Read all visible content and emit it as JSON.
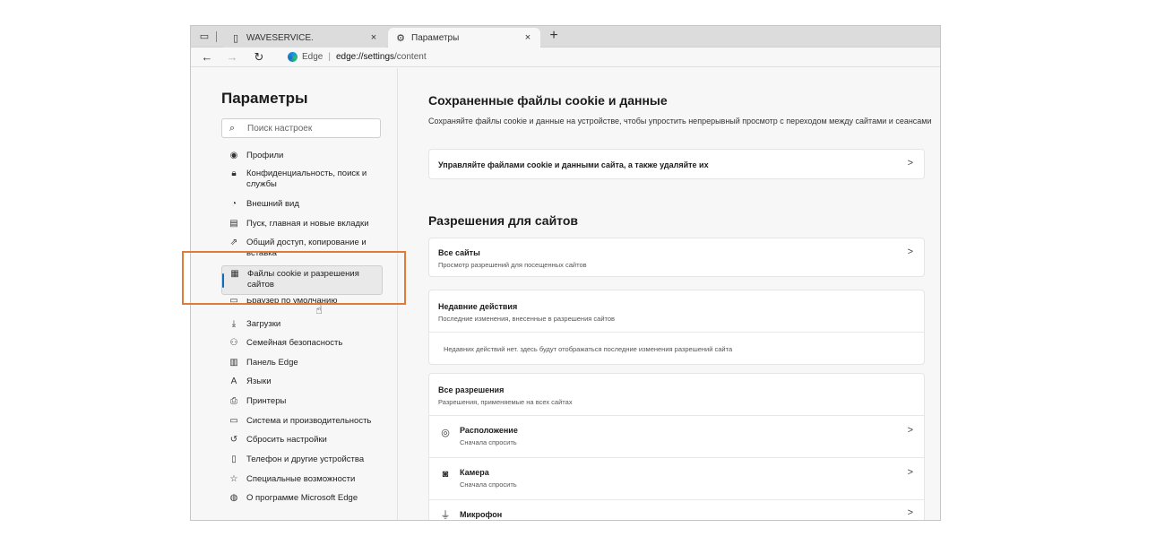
{
  "browser": {
    "tabs": [
      {
        "label": "WAVESERVICE.",
        "icon": "page-icon",
        "close": "×"
      },
      {
        "label": "Параметры",
        "icon": "gear-icon",
        "close": "×"
      }
    ],
    "new_tab": "+",
    "address": {
      "site_label": "Edge",
      "url_host": "edge://settings",
      "url_path": "/content"
    }
  },
  "sidebar": {
    "title": "Параметры",
    "search_placeholder": "Поиск настроек",
    "items": [
      {
        "label": "Профили",
        "icon": "profile-icon"
      },
      {
        "label": "Конфиденциальность, поиск и службы",
        "icon": "lock-icon"
      },
      {
        "label": "Внешний вид",
        "icon": "appearance-icon"
      },
      {
        "label": "Пуск, главная и новые вкладки",
        "icon": "start-icon"
      },
      {
        "label": "Общий доступ, копирование и вставка",
        "icon": "share-icon"
      },
      {
        "label": "Файлы cookie и разрешения сайтов",
        "icon": "cookie-icon",
        "selected": true
      },
      {
        "label": "Браузер по умолчанию",
        "icon": "browser-icon"
      },
      {
        "label": "Загрузки",
        "icon": "download-icon"
      },
      {
        "label": "Семейная безопасность",
        "icon": "family-icon"
      },
      {
        "label": "Панель Edge",
        "icon": "panel-icon"
      },
      {
        "label": "Языки",
        "icon": "language-icon"
      },
      {
        "label": "Принтеры",
        "icon": "printer-icon"
      },
      {
        "label": "Система и производительность",
        "icon": "system-icon"
      },
      {
        "label": "Сбросить настройки",
        "icon": "reset-icon"
      },
      {
        "label": "Телефон и другие устройства",
        "icon": "phone-icon"
      },
      {
        "label": "Специальные возможности",
        "icon": "accessibility-icon"
      },
      {
        "label": "О программе Microsoft Edge",
        "icon": "edge-icon"
      }
    ]
  },
  "main": {
    "cookies": {
      "title": "Сохраненные файлы cookie и данные",
      "description": "Сохраняйте файлы cookie и данные на устройстве, чтобы упростить непрерывный просмотр с переходом между сайтами и сеансами",
      "manage_label": "Управляйте файлами cookie и данными сайта, а также удаляйте их"
    },
    "site_permissions": {
      "title": "Разрешения для сайтов",
      "all_sites": {
        "title": "Все сайты",
        "subtitle": "Просмотр разрешений для посещенных сайтов"
      },
      "recent": {
        "title": "Недавние действия",
        "subtitle": "Последние изменения, внесенные в разрешения сайтов",
        "empty": "Недавних действий нет. здесь будут отображаться последние изменения разрешений сайта"
      },
      "all_permissions": {
        "title": "Все разрешения",
        "subtitle": "Разрешения, применяемые на всех сайтах",
        "items": [
          {
            "title": "Расположение",
            "subtitle": "Сначала спросить",
            "icon": "location-icon"
          },
          {
            "title": "Камера",
            "subtitle": "Сначала спросить",
            "icon": "camera-icon"
          },
          {
            "title": "Микрофон",
            "subtitle": "",
            "icon": "microphone-icon"
          }
        ]
      }
    }
  },
  "highlight_color": "#e07b39",
  "accent_color": "#0f6cbd"
}
